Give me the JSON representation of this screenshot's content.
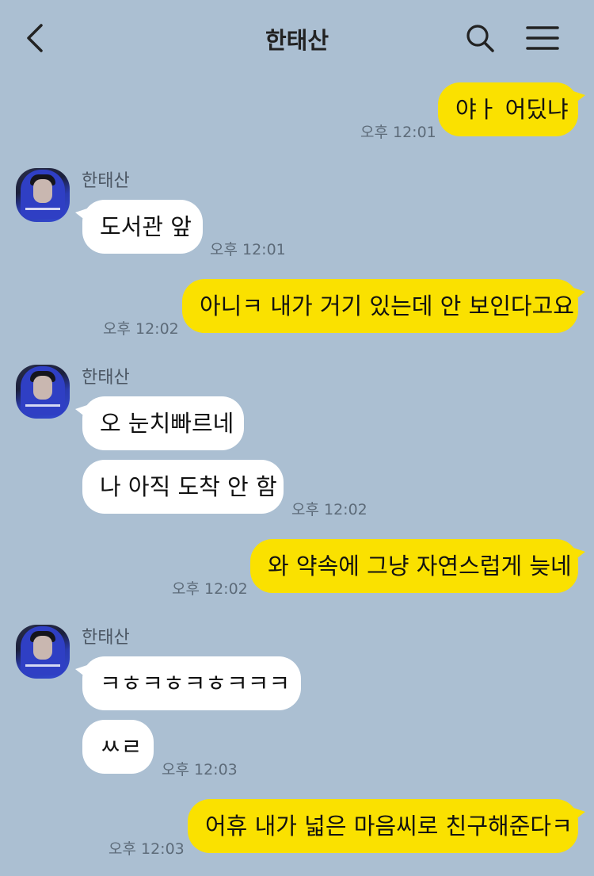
{
  "header": {
    "title": "한태산",
    "back_icon": "chevron-left-icon",
    "search_icon": "search-icon",
    "menu_icon": "hamburger-menu-icon"
  },
  "colors": {
    "background": "#abbfd2",
    "my_bubble": "#fae100",
    "their_bubble": "#ffffff"
  },
  "messages": [
    {
      "from": "me",
      "text": "야ㅏ 어딨냐",
      "time": "오후 12:01"
    },
    {
      "from": "them",
      "sender": "한태산",
      "text": "도서관 앞",
      "time": "오후 12:01"
    },
    {
      "from": "me",
      "text": "아니ㅋ 내가 거기 있는데 안 보인다고요",
      "time": "오후 12:02"
    },
    {
      "from": "them",
      "sender": "한태산",
      "text": "오 눈치빠르네",
      "time": ""
    },
    {
      "from": "them",
      "text": "나 아직 도착 안 함",
      "time": "오후 12:02"
    },
    {
      "from": "me",
      "text": "와 약속에 그냥 자연스럽게 늦네",
      "time": "오후 12:02"
    },
    {
      "from": "them",
      "sender": "한태산",
      "text": "ㅋㅎㅋㅎㅋㅎㅋㅋㅋ",
      "time": ""
    },
    {
      "from": "them",
      "text": "ㅆㄹ",
      "time": "오후 12:03"
    },
    {
      "from": "me",
      "text": "어휴 내가 넓은 마음씨로 친구해준다ㅋ",
      "time": "오후 12:03"
    }
  ]
}
